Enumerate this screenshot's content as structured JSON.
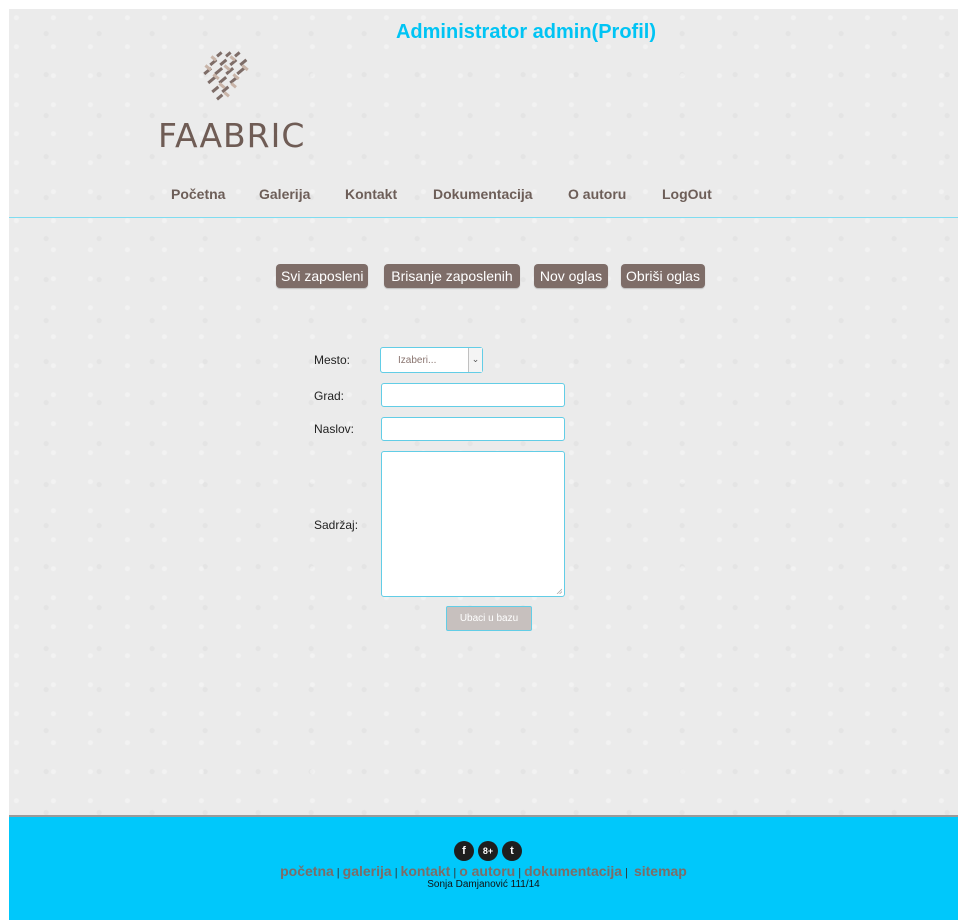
{
  "header": {
    "admin_title": "Administrator admin(Profil)",
    "logo_text": "FAABRIC",
    "logo_icon": "woven-fabric-logo"
  },
  "nav": {
    "items": [
      {
        "label": "Početna"
      },
      {
        "label": "Galerija"
      },
      {
        "label": "Kontakt"
      },
      {
        "label": "Dokumentacija"
      },
      {
        "label": "O autoru"
      },
      {
        "label": "LogOut"
      }
    ]
  },
  "admin_actions": [
    {
      "label": "Svi zaposleni"
    },
    {
      "label": "Brisanje zaposlenih"
    },
    {
      "label": "Nov oglas"
    },
    {
      "label": "Obriši oglas"
    }
  ],
  "form": {
    "mesto_label": "Mesto:",
    "mesto_selected": "Izaberi...",
    "grad_label": "Grad:",
    "grad_value": "",
    "naslov_label": "Naslov:",
    "naslov_value": "",
    "sadrzaj_label": "Sadržaj:",
    "sadrzaj_value": "",
    "submit_label": "Ubaci u bazu"
  },
  "footer": {
    "social_icons": [
      "facebook-icon",
      "google-plus-icon",
      "twitter-icon"
    ],
    "social_glyphs": [
      "f",
      "8+",
      "t"
    ],
    "links": [
      {
        "label": "početna"
      },
      {
        "label": "galerija"
      },
      {
        "label": "kontakt"
      },
      {
        "label": "o autoru"
      },
      {
        "label": "dokumentacija"
      },
      {
        "label": "sitemap"
      }
    ],
    "separator": "|",
    "credit": "Sonja Damjanović 111/14"
  },
  "colors": {
    "accent": "#00c4f4",
    "footer_bg": "#00c8fb",
    "button_bg": "#7e6d68",
    "link": "#6d5e58",
    "page_bg": "#ebebeb"
  }
}
